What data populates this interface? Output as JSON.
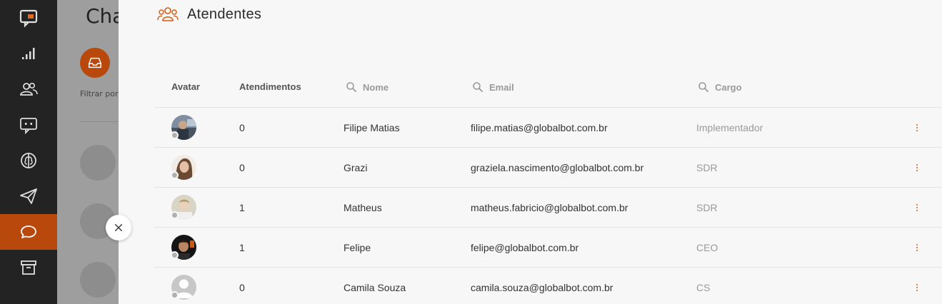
{
  "nav": {
    "items": [
      {
        "name": "logo",
        "icon": "chat-logo-icon"
      },
      {
        "name": "reports",
        "icon": "signal-bars-icon"
      },
      {
        "name": "attendants",
        "icon": "users-icon"
      },
      {
        "name": "bots",
        "icon": "bot-chat-icon"
      },
      {
        "name": "brain",
        "icon": "brain-icon"
      },
      {
        "name": "campaigns",
        "icon": "paper-plane-icon"
      },
      {
        "name": "chats",
        "icon": "chat-bubble-icon",
        "active": true
      },
      {
        "name": "archive",
        "icon": "archive-icon"
      }
    ]
  },
  "underlay": {
    "title": "Cha",
    "filter_label": "Filtrar por"
  },
  "panel": {
    "title": "Atendentes",
    "columns": {
      "avatar": "Avatar",
      "attendances": "Atendimentos",
      "name": "Nome",
      "email": "Email",
      "role": "Cargo"
    },
    "rows": [
      {
        "attendances": "0",
        "name": "Filipe Matias",
        "email": "filipe.matias@globalbot.com.br",
        "role": "Implementador"
      },
      {
        "attendances": "0",
        "name": "Grazi",
        "email": "graziela.nascimento@globalbot.com.br",
        "role": "SDR"
      },
      {
        "attendances": "1",
        "name": "Matheus",
        "email": "matheus.fabricio@globalbot.com.br",
        "role": "SDR"
      },
      {
        "attendances": "1",
        "name": "Felipe",
        "email": "felipe@globalbot.com.br",
        "role": "CEO"
      },
      {
        "attendances": "0",
        "name": "Camila Souza",
        "email": "camila.souza@globalbot.com.br",
        "role": "CS"
      }
    ]
  },
  "colors": {
    "accent": "#d65a12",
    "nav_bg": "#232323",
    "nav_active": "#b8480b"
  }
}
